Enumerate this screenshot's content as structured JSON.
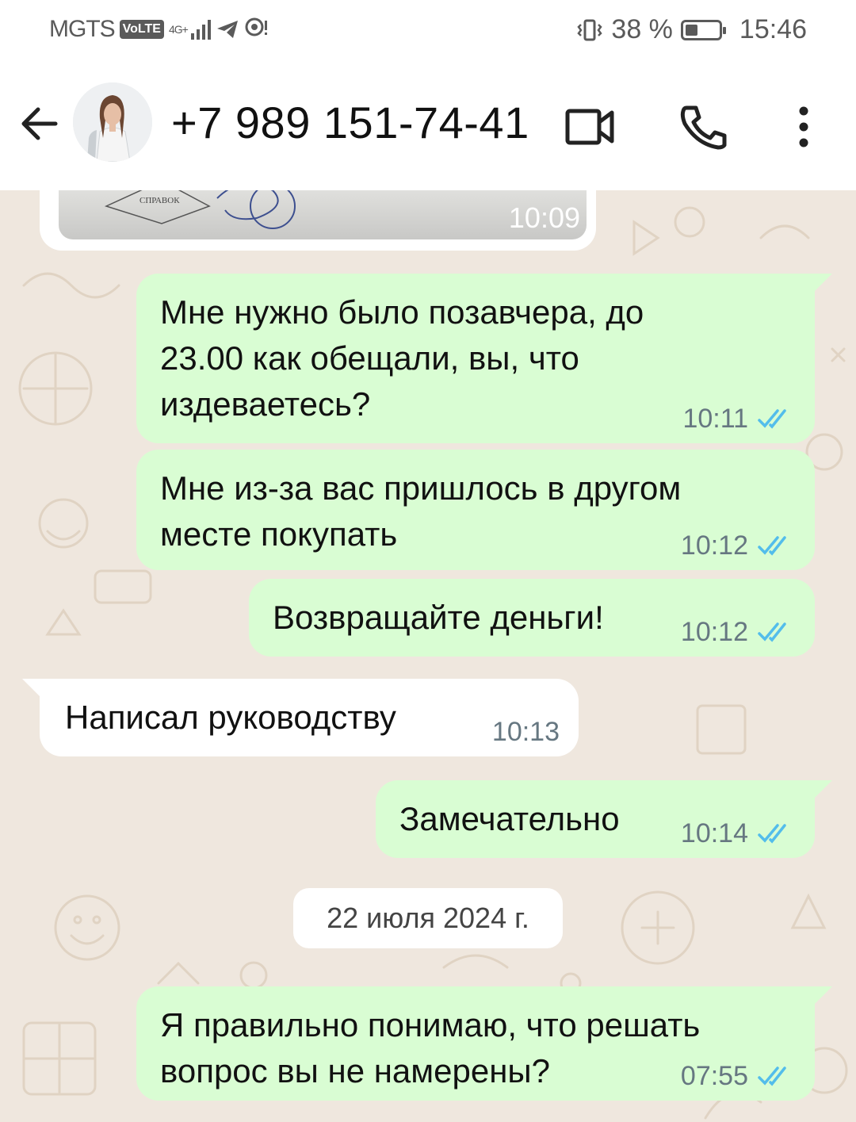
{
  "status_bar": {
    "carrier": "MGTS",
    "volte": "VoLTE",
    "network": "4G+",
    "battery_percent": "38 %",
    "battery_level": 0.38,
    "time": "15:46"
  },
  "header": {
    "contact": "+7 989 151-74-41",
    "icons": [
      "back-arrow-icon",
      "avatar",
      "video-call-icon",
      "phone-icon",
      "more-vert-icon"
    ]
  },
  "chat": {
    "image_message": {
      "time": "10:09",
      "stamp_text": "СПРАВОК"
    },
    "messages": [
      {
        "direction": "out",
        "text": "Мне нужно было позавчера, до\n23.00 как обещали, вы, что\nиздеваетесь?",
        "time": "10:11",
        "status": "read"
      },
      {
        "direction": "out",
        "text": "Мне из-за вас пришлось в другом\nместе покупать",
        "time": "10:12",
        "status": "read"
      },
      {
        "direction": "out",
        "text": "Возвращайте деньги!",
        "time": "10:12",
        "status": "read"
      },
      {
        "direction": "in",
        "text": "Написал руководству",
        "time": "10:13"
      },
      {
        "direction": "out",
        "text": "Замечательно",
        "time": "10:14",
        "status": "read"
      },
      {
        "direction": "out",
        "text": "Я правильно понимаю, что решать\nвопрос вы не намерены?",
        "time": "07:55",
        "status": "read"
      }
    ],
    "date_separator": "22 июля 2024 г."
  },
  "colors": {
    "outgoing_bubble": "#d9fdd3",
    "incoming_bubble": "#ffffff",
    "chat_background": "#efe7de",
    "read_tick": "#53bdeb"
  }
}
